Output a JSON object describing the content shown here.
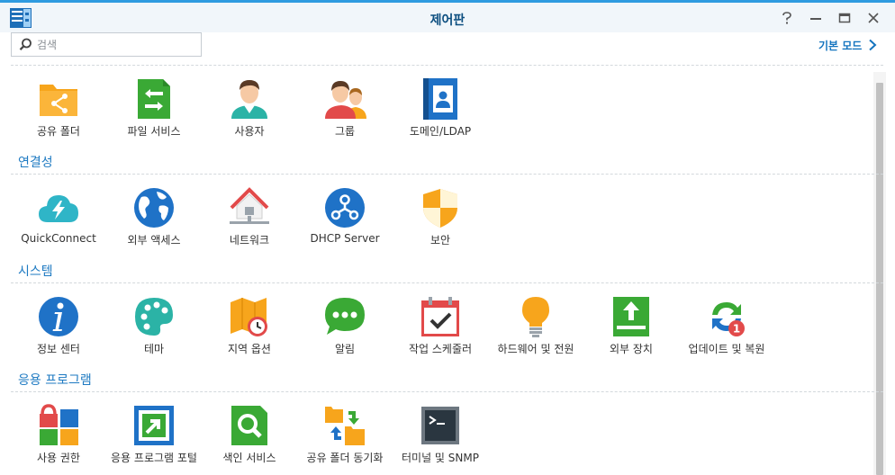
{
  "window": {
    "title": "제어판",
    "app_icon": "control-panel-icon",
    "controls": [
      "help-icon",
      "minimize-icon",
      "maximize-icon",
      "close-icon"
    ]
  },
  "search": {
    "placeholder": "검색",
    "value": ""
  },
  "mode_switch": {
    "label": "기본 모드"
  },
  "sections": [
    {
      "title": "",
      "items": [
        {
          "label": "공유 폴더",
          "icon": "shared-folder-icon"
        },
        {
          "label": "파일 서비스",
          "icon": "file-services-icon"
        },
        {
          "label": "사용자",
          "icon": "user-icon"
        },
        {
          "label": "그룹",
          "icon": "group-icon"
        },
        {
          "label": "도메인/LDAP",
          "icon": "domain-ldap-icon"
        }
      ]
    },
    {
      "title": "연결성",
      "items": [
        {
          "label": "QuickConnect",
          "icon": "quickconnect-icon"
        },
        {
          "label": "외부 액세스",
          "icon": "external-access-icon"
        },
        {
          "label": "네트워크",
          "icon": "network-icon"
        },
        {
          "label": "DHCP Server",
          "icon": "dhcp-server-icon"
        },
        {
          "label": "보안",
          "icon": "security-icon"
        }
      ]
    },
    {
      "title": "시스템",
      "items": [
        {
          "label": "정보 센터",
          "icon": "info-center-icon"
        },
        {
          "label": "테마",
          "icon": "theme-icon"
        },
        {
          "label": "지역 옵션",
          "icon": "regional-options-icon"
        },
        {
          "label": "알림",
          "icon": "notification-icon"
        },
        {
          "label": "작업 스케줄러",
          "icon": "task-scheduler-icon"
        },
        {
          "label": "하드웨어 및 전원",
          "icon": "hardware-power-icon"
        },
        {
          "label": "외부 장치",
          "icon": "external-devices-icon"
        },
        {
          "label": "업데이트 및 복원",
          "icon": "update-restore-icon",
          "badge": "1"
        }
      ]
    },
    {
      "title": "응용 프로그램",
      "items": [
        {
          "label": "사용 권한",
          "icon": "privileges-icon"
        },
        {
          "label": "응용 프로그램 포털",
          "icon": "application-portal-icon"
        },
        {
          "label": "색인 서비스",
          "icon": "indexing-service-icon"
        },
        {
          "label": "공유 폴더 동기화",
          "icon": "shared-folder-sync-icon"
        },
        {
          "label": "터미널 및 SNMP",
          "icon": "terminal-snmp-icon"
        }
      ]
    }
  ]
}
